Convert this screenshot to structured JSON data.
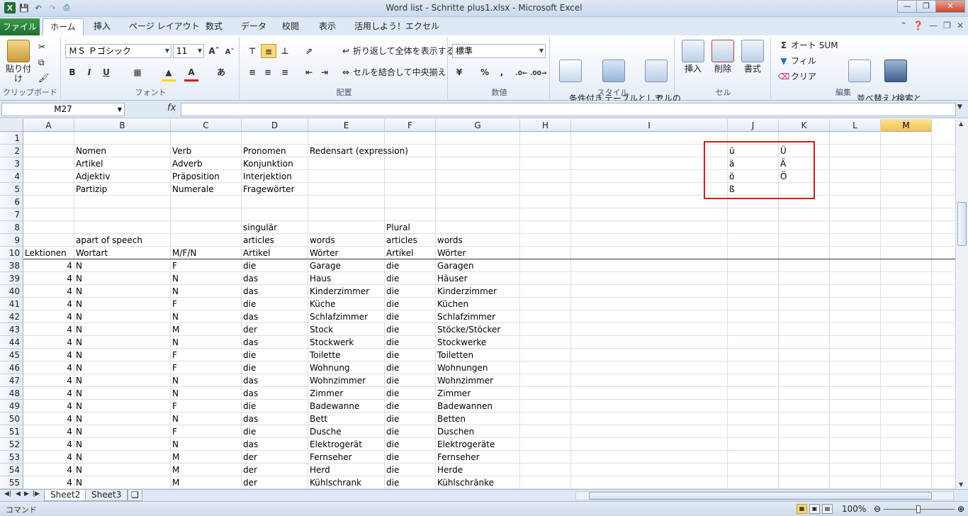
{
  "window": {
    "title": "Word list - Schritte plus1.xlsx  -  Microsoft Excel"
  },
  "ribbon_tabs": [
    "ファイル",
    "ホーム",
    "挿入",
    "ページ レイアウト",
    "数式",
    "データ",
    "校閲",
    "表示",
    "活用しよう！エクセル"
  ],
  "ribbon": {
    "clipboard": {
      "paste": "貼り付け",
      "label": "クリップボード"
    },
    "font": {
      "name": "ＭＳ Ｐゴシック",
      "size": "11",
      "label": "フォント",
      "bold": "B",
      "italic": "I",
      "underline": "U"
    },
    "alignment": {
      "wrap": "折り返して全体を表示する",
      "merge": "セルを結合して中央揃え",
      "label": "配置"
    },
    "number": {
      "format": "標準",
      "label": "数値",
      "percent": "%",
      "comma": ","
    },
    "styles": {
      "conditional": "条件付き\n書式",
      "table": "テーブルとして\n書式設定",
      "cell": "セルの\nスタイル",
      "label": "スタイル"
    },
    "cells": {
      "insert": "挿入",
      "delete": "削除",
      "format": "書式",
      "label": "セル"
    },
    "editing": {
      "autosum": "オート SUM",
      "fill": "フィル",
      "clear": "クリア",
      "sort": "並べ替えと\nフィルター",
      "find": "検索と\n選択",
      "label": "編集"
    }
  },
  "formula_bar": {
    "name_box": "M27",
    "fx": "fx",
    "formula": ""
  },
  "columns": [
    "A",
    "B",
    "C",
    "D",
    "E",
    "F",
    "G",
    "H",
    "I",
    "J",
    "K",
    "L",
    "M"
  ],
  "selected_column": "M",
  "rows": [
    {
      "n": "1",
      "cells": {}
    },
    {
      "n": "2",
      "cells": {
        "B": "Nomen",
        "C": "Verb",
        "D": "Pronomen",
        "E": "Redensart (expression)",
        "J": "ü",
        "K": "Ü"
      }
    },
    {
      "n": "3",
      "cells": {
        "B": "Artikel",
        "C": "Adverb",
        "D": "Konjunktion",
        "J": "ä",
        "K": "Ä"
      }
    },
    {
      "n": "4",
      "cells": {
        "B": "Adjektiv",
        "C": "Präposition",
        "D": "Interjektion",
        "J": "ö",
        "K": "Ö"
      }
    },
    {
      "n": "5",
      "cells": {
        "B": "Partizip",
        "C": "Numerale",
        "D": "Fragewörter",
        "J": "ß"
      }
    },
    {
      "n": "6",
      "cells": {}
    },
    {
      "n": "7",
      "cells": {}
    },
    {
      "n": "8",
      "cells": {
        "D": "singulär",
        "F": "Plural"
      }
    },
    {
      "n": "9",
      "cells": {
        "B": "apart of speech",
        "D": "articles",
        "E": "words",
        "F": "articles",
        "G": "words"
      }
    },
    {
      "n": "10",
      "cells": {
        "A": "Lektionen",
        "B": "Wortart",
        "C": "M/F/N",
        "D": "Artikel",
        "E": "Wörter",
        "F": "Artikel",
        "G": "Wörter"
      }
    },
    {
      "n": "38",
      "cells": {
        "A": "4",
        "B": "N",
        "C": "F",
        "D": "die",
        "E": "Garage",
        "F": "die",
        "G": "Garagen"
      }
    },
    {
      "n": "39",
      "cells": {
        "A": "4",
        "B": "N",
        "C": "N",
        "D": "das",
        "E": "Haus",
        "F": "die",
        "G": "Häuser"
      }
    },
    {
      "n": "40",
      "cells": {
        "A": "4",
        "B": "N",
        "C": "N",
        "D": "das",
        "E": "Kinderzimmer",
        "F": "die",
        "G": "Kinderzimmer"
      }
    },
    {
      "n": "41",
      "cells": {
        "A": "4",
        "B": "N",
        "C": "F",
        "D": "die",
        "E": "Küche",
        "F": "die",
        "G": "Küchen"
      }
    },
    {
      "n": "42",
      "cells": {
        "A": "4",
        "B": "N",
        "C": "N",
        "D": "das",
        "E": "Schlafzimmer",
        "F": "die",
        "G": "Schlafzimmer"
      }
    },
    {
      "n": "43",
      "cells": {
        "A": "4",
        "B": "N",
        "C": "M",
        "D": "der",
        "E": "Stock",
        "F": "die",
        "G": "Stöcke/Stöcker"
      }
    },
    {
      "n": "44",
      "cells": {
        "A": "4",
        "B": "N",
        "C": "N",
        "D": "das",
        "E": "Stockwerk",
        "F": "die",
        "G": "Stockwerke"
      }
    },
    {
      "n": "45",
      "cells": {
        "A": "4",
        "B": "N",
        "C": "F",
        "D": "die",
        "E": "Toilette",
        "F": "die",
        "G": "Toiletten"
      }
    },
    {
      "n": "46",
      "cells": {
        "A": "4",
        "B": "N",
        "C": "F",
        "D": "die",
        "E": "Wohnung",
        "F": "die",
        "G": "Wohnungen"
      }
    },
    {
      "n": "47",
      "cells": {
        "A": "4",
        "B": "N",
        "C": "N",
        "D": "das",
        "E": "Wohnzimmer",
        "F": "die",
        "G": "Wohnzimmer"
      }
    },
    {
      "n": "48",
      "cells": {
        "A": "4",
        "B": "N",
        "C": "N",
        "D": "das",
        "E": "Zimmer",
        "F": "die",
        "G": "Zimmer"
      }
    },
    {
      "n": "49",
      "cells": {
        "A": "4",
        "B": "N",
        "C": "F",
        "D": "die",
        "E": "Badewanne",
        "F": "die",
        "G": "Badewannen"
      }
    },
    {
      "n": "50",
      "cells": {
        "A": "4",
        "B": "N",
        "C": "N",
        "D": "das",
        "E": "Bett",
        "F": "die",
        "G": "Betten"
      }
    },
    {
      "n": "51",
      "cells": {
        "A": "4",
        "B": "N",
        "C": "F",
        "D": "die",
        "E": "Dusche",
        "F": "die",
        "G": "Duschen"
      }
    },
    {
      "n": "52",
      "cells": {
        "A": "4",
        "B": "N",
        "C": "N",
        "D": "das",
        "E": "Elektrogerät",
        "F": "die",
        "G": "Elektrogeräte"
      }
    },
    {
      "n": "53",
      "cells": {
        "A": "4",
        "B": "N",
        "C": "M",
        "D": "der",
        "E": "Fernseher",
        "F": "die",
        "G": "Fernseher"
      }
    },
    {
      "n": "54",
      "cells": {
        "A": "4",
        "B": "N",
        "C": "M",
        "D": "der",
        "E": "Herd",
        "F": "die",
        "G": "Herde"
      }
    },
    {
      "n": "55",
      "cells": {
        "A": "4",
        "B": "N",
        "C": "M",
        "D": "der",
        "E": "Kühlschrank",
        "F": "die",
        "G": "Kühlschränke"
      }
    }
  ],
  "sheets": [
    "Sheet2",
    "Sheet3"
  ],
  "active_sheet": "Sheet2",
  "status": {
    "mode": "コマンド",
    "zoom": "100%"
  }
}
